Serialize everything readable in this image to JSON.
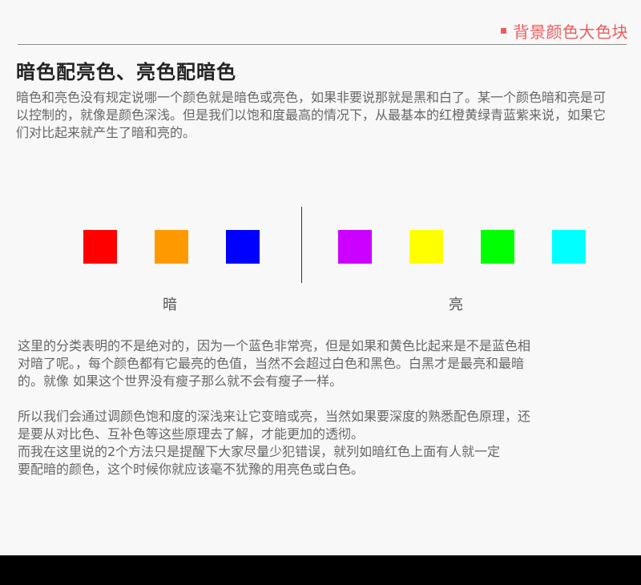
{
  "header": {
    "section_label": "背景颜色大色块"
  },
  "title": "暗色配亮色、亮色配暗色",
  "intro": "暗色和亮色没有规定说哪一个颜色就是暗色或亮色，如果非要说那就是黑和白了。某一个颜色暗和亮是可以控制的，就像是颜色深浅。但是我们以饱和度最高的情况下，从最基本的红橙黄绿青蓝紫来说，如果它们对比起来就产生了暗和亮的。",
  "swatches": {
    "dark": [
      {
        "name": "red",
        "color": "#ff0000"
      },
      {
        "name": "orange",
        "color": "#ff9900"
      },
      {
        "name": "blue",
        "color": "#0000ff"
      }
    ],
    "light": [
      {
        "name": "purple",
        "color": "#cc00ff"
      },
      {
        "name": "yellow",
        "color": "#ffff00"
      },
      {
        "name": "green",
        "color": "#00ff00"
      },
      {
        "name": "cyan",
        "color": "#00ffff"
      }
    ]
  },
  "captions": {
    "dark": "暗",
    "light": "亮"
  },
  "body_lines": [
    "这里的分类表明的不是绝对的，因为一个蓝色非常亮，但是如果和黄色比起来是不是蓝色相",
    "对暗了呢。，每个颜色都有它最亮的色值，当然不会超过白色和黑色。白黑才是最亮和最暗",
    "的。就像  如果这个世界没有瘦子那么就不会有瘦子一样。",
    "",
    "所以我们会通过调颜色饱和度的深浅来让它变暗或亮，当然如果要深度的熟悉配色原理，还",
    "是要从对比色、互补色等这些原理去了解，才能更加的透彻。",
    "而我在这里说的2个方法只是提醒下大家尽量少犯错误，就列如暗红色上面有人就一定",
    "要配暗的颜色，这个时候你就应该毫不犹豫的用亮色或白色。"
  ],
  "colors": {
    "accent": "#ef5b5b",
    "footer": "#000000"
  }
}
